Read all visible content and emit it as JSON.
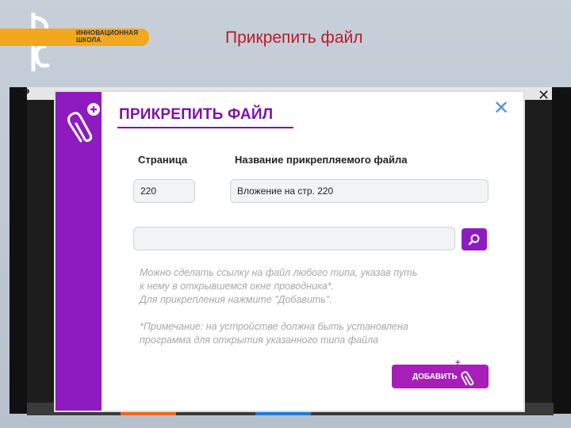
{
  "header": {
    "org_line1": "ИННОВАЦИОННАЯ",
    "org_line2": "ШКОЛА",
    "slide_title": "Прикрепить файл"
  },
  "dialog": {
    "heading": "ПРИКРЕПИТЬ ФАЙЛ",
    "page_label": "Страница",
    "filename_label": "Название прикрепляемого файла",
    "page_value": "220",
    "filename_value": "Вложение на стр. 220",
    "path_value": "",
    "hint_lines": [
      "Можно сделать ссылку на файл любого типа, указав путь",
      "к нему в открывшемся окне проводника*.",
      "Для прикрепления нажмите \"Добавить\"."
    ],
    "note_lines": [
      "*Примечание: на устройстве должна быть установлена",
      "программа для открытия указанного типа файла"
    ],
    "add_label": "ДОБАВИТЬ",
    "add_plus": "+"
  },
  "outer": {
    "help_glyph": "?",
    "close_glyph": "✕"
  },
  "colors": {
    "accent_purple": "#8e1bbf",
    "title_red": "#c0182a",
    "logo_orange": "#f2a81c"
  },
  "icons": [
    "logo-icon",
    "paperclip-icon",
    "close-icon",
    "search-icon",
    "help-icon"
  ]
}
